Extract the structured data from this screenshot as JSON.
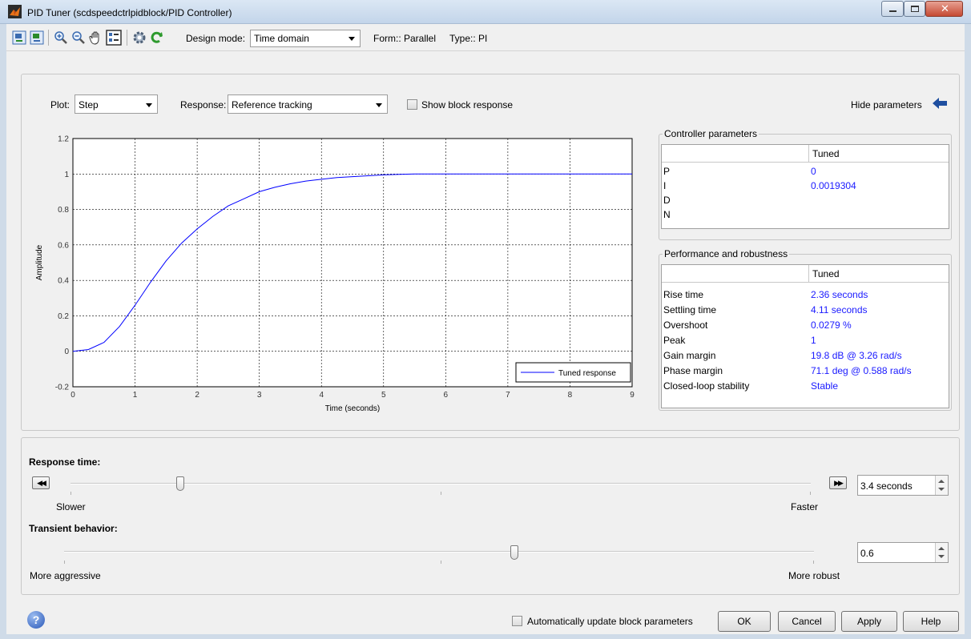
{
  "window": {
    "title": "PID Tuner (scdspeedctrlpidblock/PID Controller)"
  },
  "toolbar": {
    "design_mode_label": "Design mode:",
    "design_mode_value": "Time domain",
    "form_text": "Form:: Parallel",
    "type_text": "Type:: PI"
  },
  "plot_controls": {
    "plot_label": "Plot:",
    "plot_value": "Step",
    "response_label": "Response:",
    "response_value": "Reference tracking",
    "show_block_response": "Show block response",
    "hide_parameters": "Hide parameters"
  },
  "chart_data": {
    "type": "line",
    "title": "",
    "xlabel": "Time (seconds)",
    "ylabel": "Amplitude",
    "xlim": [
      0,
      9
    ],
    "ylim": [
      -0.2,
      1.2
    ],
    "xticks": [
      "0",
      "1",
      "2",
      "3",
      "4",
      "5",
      "6",
      "7",
      "8",
      "9"
    ],
    "yticks": [
      "1.2",
      "1",
      "0.8",
      "0.6",
      "0.4",
      "0.2",
      "0",
      "-0.2"
    ],
    "grid": true,
    "legend_position": "bottom-right",
    "series": [
      {
        "name": "Tuned response",
        "color": "#0000ff",
        "x": [
          0,
          0.25,
          0.5,
          0.75,
          1.0,
          1.25,
          1.5,
          1.75,
          2.0,
          2.25,
          2.5,
          2.75,
          3.0,
          3.25,
          3.5,
          3.75,
          4.0,
          4.25,
          4.5,
          4.75,
          5.0,
          5.25,
          5.5,
          6.0,
          7.0,
          8.0,
          9.0
        ],
        "y": [
          0,
          0.01,
          0.05,
          0.14,
          0.26,
          0.39,
          0.51,
          0.61,
          0.69,
          0.76,
          0.82,
          0.86,
          0.9,
          0.925,
          0.945,
          0.96,
          0.97,
          0.98,
          0.985,
          0.99,
          0.995,
          0.998,
          1.0,
          1.0,
          1.0,
          1.0,
          1.0
        ]
      }
    ]
  },
  "controller_parameters": {
    "title": "Controller parameters",
    "column": "Tuned",
    "rows": [
      {
        "name": "P",
        "value": "0"
      },
      {
        "name": "I",
        "value": "0.0019304"
      },
      {
        "name": "D",
        "value": ""
      },
      {
        "name": "N",
        "value": ""
      }
    ]
  },
  "performance": {
    "title": "Performance and robustness",
    "column": "Tuned",
    "rows": [
      {
        "name": "Rise time",
        "value": "2.36 seconds"
      },
      {
        "name": "Settling time",
        "value": "4.11 seconds"
      },
      {
        "name": "Overshoot",
        "value": "0.0279 %"
      },
      {
        "name": "Peak",
        "value": "1"
      },
      {
        "name": "Gain margin",
        "value": "19.8 dB @ 3.26 rad/s"
      },
      {
        "name": "Phase margin",
        "value": "71.1 deg @ 0.588 rad/s"
      },
      {
        "name": "Closed-loop stability",
        "value": "Stable"
      }
    ]
  },
  "response_time": {
    "label": "Response time:",
    "slower": "Slower",
    "faster": "Faster",
    "value": "3.4 seconds",
    "slider_position": 0.148
  },
  "transient": {
    "label": "Transient behavior:",
    "left": "More aggressive",
    "right": "More robust",
    "value": "0.6",
    "slider_position": 0.6
  },
  "footer": {
    "auto_update": "Automatically update block parameters",
    "ok": "OK",
    "cancel": "Cancel",
    "apply": "Apply",
    "help": "Help"
  }
}
